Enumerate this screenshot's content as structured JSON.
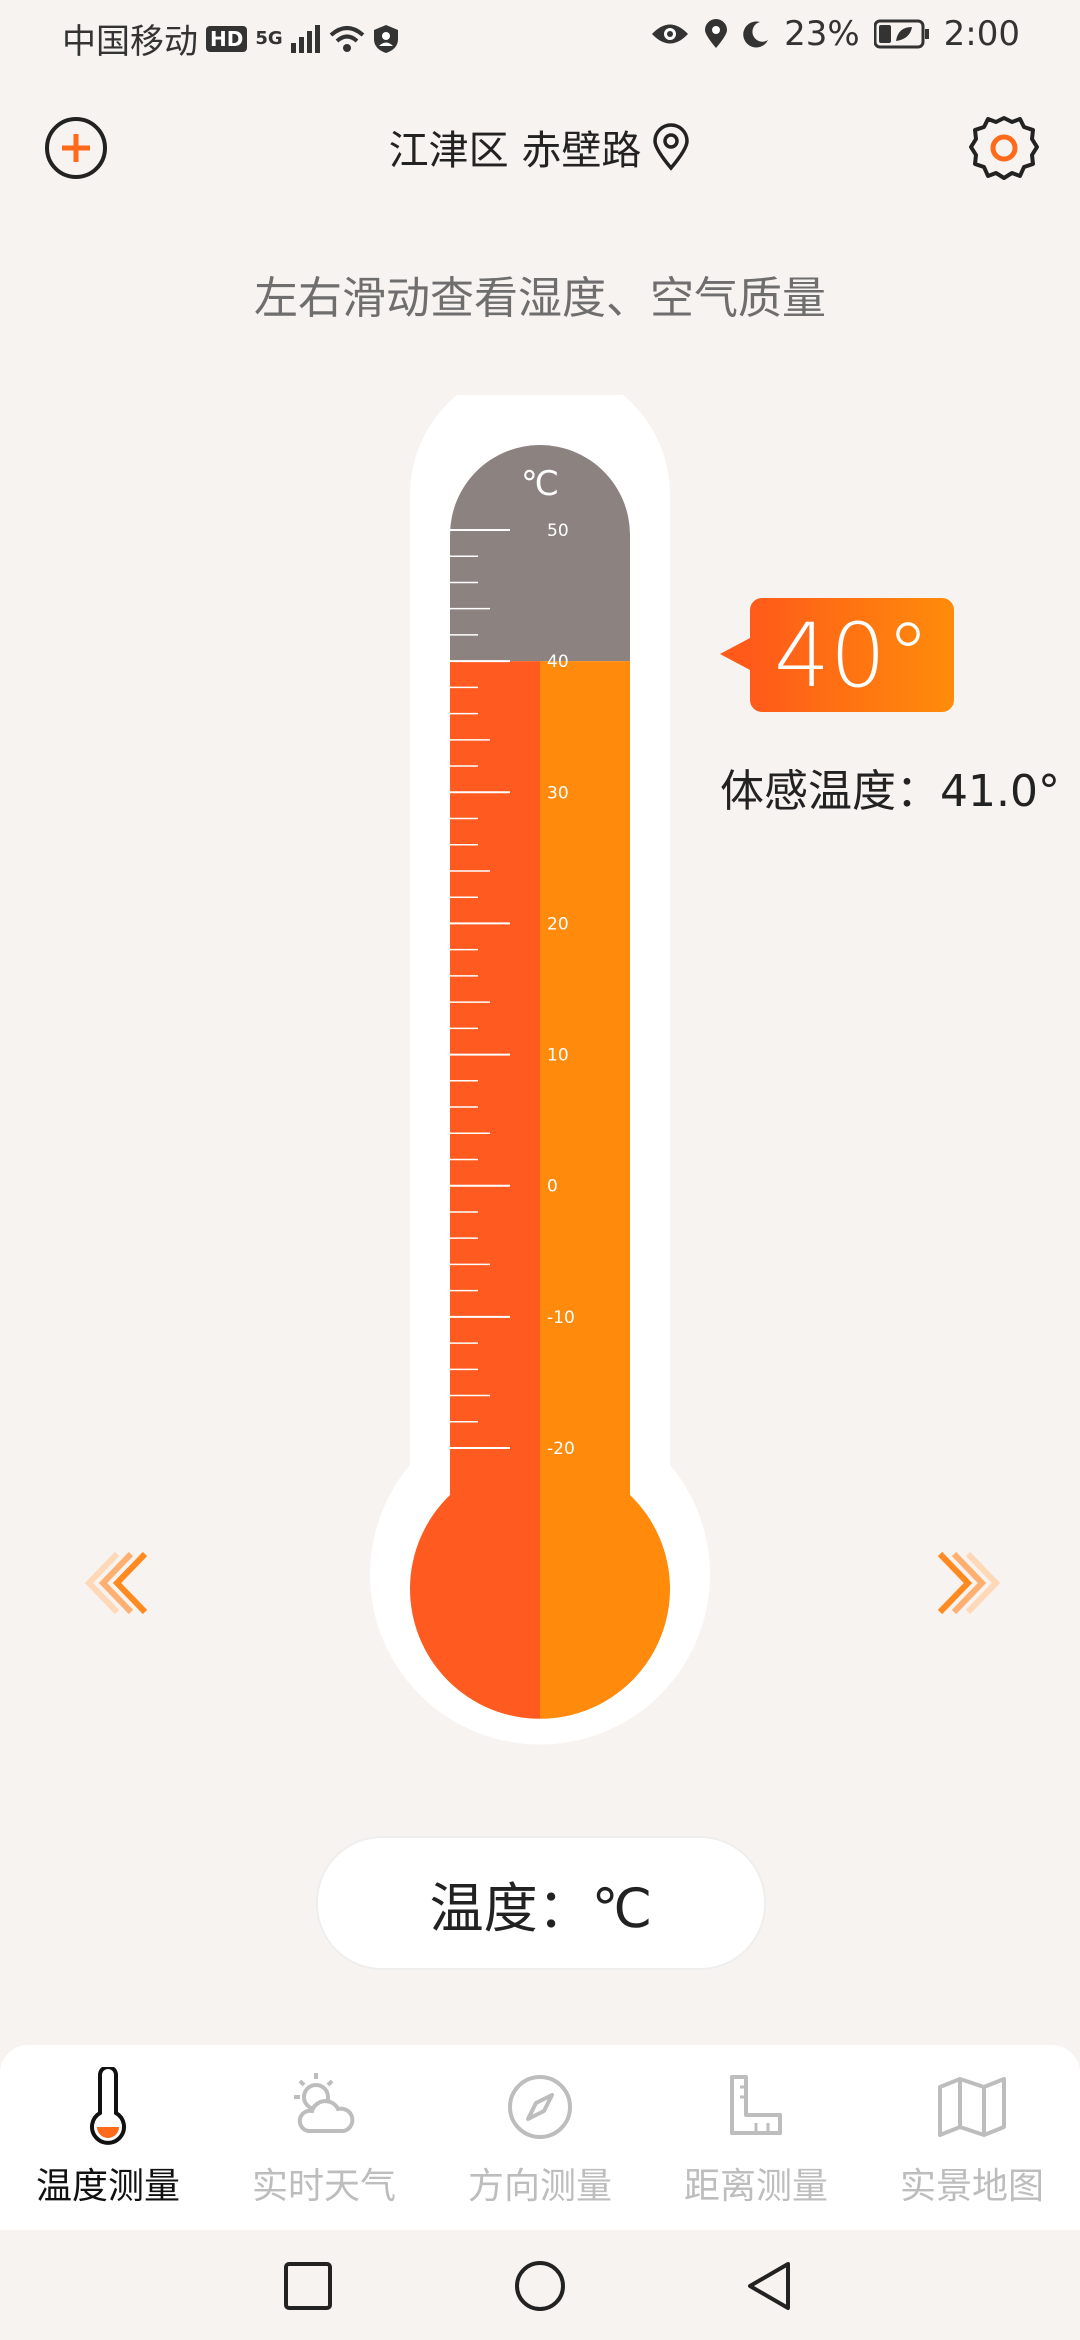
{
  "status_bar": {
    "carrier": "中国移动",
    "hd": "HD",
    "network": "5G",
    "battery": "23%",
    "time": "2:00"
  },
  "header": {
    "location": "江津区 赤壁路"
  },
  "hint": "左右滑动查看湿度、空气质量",
  "thermometer": {
    "unit_symbol": "℃",
    "current_value": 40,
    "scale_max": 55,
    "scale_min": -25,
    "tick_labels": [
      "50",
      "40",
      "30",
      "20",
      "10",
      "0",
      "-10",
      "-20"
    ],
    "colors": {
      "empty": "#8c8381",
      "fill_left": "#ff5a1f",
      "fill_right": "#ff8a0c"
    }
  },
  "reading": {
    "temp_badge": "40°",
    "feels_like": "体感温度：41.0°"
  },
  "unit_pill": "温度：℃",
  "nav": {
    "items": [
      {
        "label": "温度测量",
        "icon": "thermometer-icon",
        "active": true
      },
      {
        "label": "实时天气",
        "icon": "weather-icon",
        "active": false
      },
      {
        "label": "方向测量",
        "icon": "compass-icon",
        "active": false
      },
      {
        "label": "距离测量",
        "icon": "ruler-icon",
        "active": false
      },
      {
        "label": "实景地图",
        "icon": "map-icon",
        "active": false
      }
    ]
  }
}
